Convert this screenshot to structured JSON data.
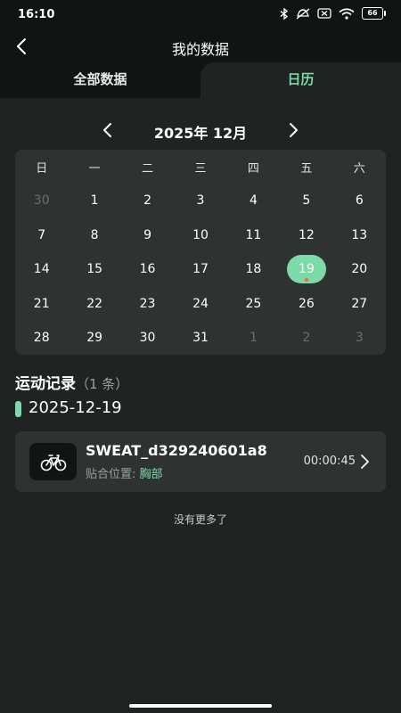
{
  "status": {
    "time": "16:10",
    "battery": "66"
  },
  "header": {
    "title": "我的数据"
  },
  "tabs": [
    {
      "label": "全部数据"
    },
    {
      "label": "日历"
    }
  ],
  "calendar": {
    "month_title": "2025年 12月",
    "weekdays": [
      "日",
      "一",
      "二",
      "三",
      "四",
      "五",
      "六"
    ],
    "rows": [
      [
        "30",
        "1",
        "2",
        "3",
        "4",
        "5",
        "6"
      ],
      [
        "7",
        "8",
        "9",
        "10",
        "11",
        "12",
        "13"
      ],
      [
        "14",
        "15",
        "16",
        "17",
        "18",
        "19",
        "20"
      ],
      [
        "21",
        "22",
        "23",
        "24",
        "25",
        "26",
        "27"
      ],
      [
        "28",
        "29",
        "30",
        "31",
        "1",
        "2",
        "3"
      ]
    ],
    "selected_day": "19"
  },
  "records": {
    "title": "运动记录",
    "count": "（1 条）",
    "date": "2025-12-19",
    "items": [
      {
        "name": "SWEAT_d329240601a8",
        "position_label": "贴合位置: ",
        "position_value": "胸部",
        "duration": "00:00:45",
        "icon": "bicycle-icon"
      }
    ],
    "no_more": "没有更多了"
  },
  "colors": {
    "accent": "#7cd9a8",
    "background": "#1f2322",
    "card": "#2e3230",
    "dot": "#f46a3d"
  }
}
